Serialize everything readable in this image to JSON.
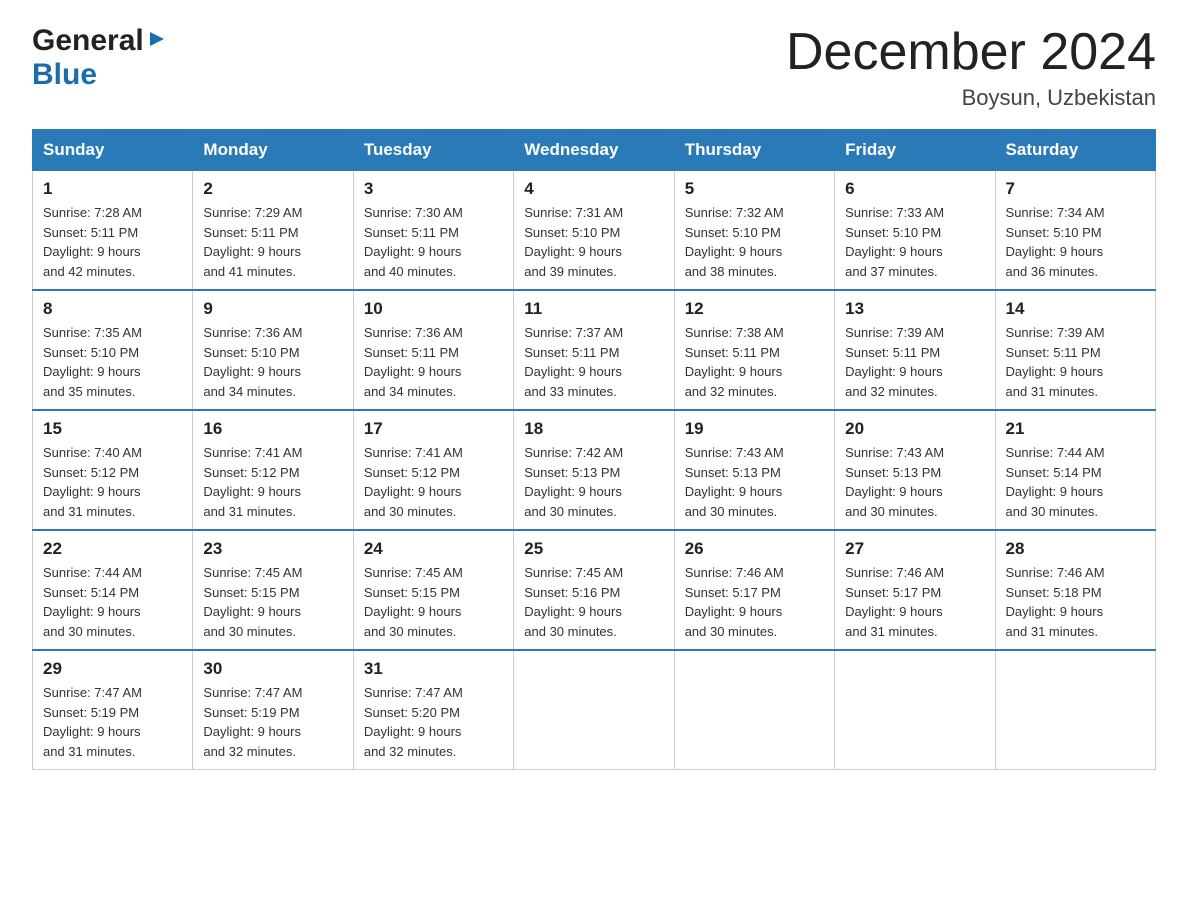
{
  "header": {
    "logo_general": "General",
    "logo_blue": "Blue",
    "title": "December 2024",
    "subtitle": "Boysun, Uzbekistan"
  },
  "days_of_week": [
    "Sunday",
    "Monday",
    "Tuesday",
    "Wednesday",
    "Thursday",
    "Friday",
    "Saturday"
  ],
  "weeks": [
    [
      {
        "day": "1",
        "sunrise": "7:28 AM",
        "sunset": "5:11 PM",
        "daylight": "9 hours and 42 minutes."
      },
      {
        "day": "2",
        "sunrise": "7:29 AM",
        "sunset": "5:11 PM",
        "daylight": "9 hours and 41 minutes."
      },
      {
        "day": "3",
        "sunrise": "7:30 AM",
        "sunset": "5:11 PM",
        "daylight": "9 hours and 40 minutes."
      },
      {
        "day": "4",
        "sunrise": "7:31 AM",
        "sunset": "5:10 PM",
        "daylight": "9 hours and 39 minutes."
      },
      {
        "day": "5",
        "sunrise": "7:32 AM",
        "sunset": "5:10 PM",
        "daylight": "9 hours and 38 minutes."
      },
      {
        "day": "6",
        "sunrise": "7:33 AM",
        "sunset": "5:10 PM",
        "daylight": "9 hours and 37 minutes."
      },
      {
        "day": "7",
        "sunrise": "7:34 AM",
        "sunset": "5:10 PM",
        "daylight": "9 hours and 36 minutes."
      }
    ],
    [
      {
        "day": "8",
        "sunrise": "7:35 AM",
        "sunset": "5:10 PM",
        "daylight": "9 hours and 35 minutes."
      },
      {
        "day": "9",
        "sunrise": "7:36 AM",
        "sunset": "5:10 PM",
        "daylight": "9 hours and 34 minutes."
      },
      {
        "day": "10",
        "sunrise": "7:36 AM",
        "sunset": "5:11 PM",
        "daylight": "9 hours and 34 minutes."
      },
      {
        "day": "11",
        "sunrise": "7:37 AM",
        "sunset": "5:11 PM",
        "daylight": "9 hours and 33 minutes."
      },
      {
        "day": "12",
        "sunrise": "7:38 AM",
        "sunset": "5:11 PM",
        "daylight": "9 hours and 32 minutes."
      },
      {
        "day": "13",
        "sunrise": "7:39 AM",
        "sunset": "5:11 PM",
        "daylight": "9 hours and 32 minutes."
      },
      {
        "day": "14",
        "sunrise": "7:39 AM",
        "sunset": "5:11 PM",
        "daylight": "9 hours and 31 minutes."
      }
    ],
    [
      {
        "day": "15",
        "sunrise": "7:40 AM",
        "sunset": "5:12 PM",
        "daylight": "9 hours and 31 minutes."
      },
      {
        "day": "16",
        "sunrise": "7:41 AM",
        "sunset": "5:12 PM",
        "daylight": "9 hours and 31 minutes."
      },
      {
        "day": "17",
        "sunrise": "7:41 AM",
        "sunset": "5:12 PM",
        "daylight": "9 hours and 30 minutes."
      },
      {
        "day": "18",
        "sunrise": "7:42 AM",
        "sunset": "5:13 PM",
        "daylight": "9 hours and 30 minutes."
      },
      {
        "day": "19",
        "sunrise": "7:43 AM",
        "sunset": "5:13 PM",
        "daylight": "9 hours and 30 minutes."
      },
      {
        "day": "20",
        "sunrise": "7:43 AM",
        "sunset": "5:13 PM",
        "daylight": "9 hours and 30 minutes."
      },
      {
        "day": "21",
        "sunrise": "7:44 AM",
        "sunset": "5:14 PM",
        "daylight": "9 hours and 30 minutes."
      }
    ],
    [
      {
        "day": "22",
        "sunrise": "7:44 AM",
        "sunset": "5:14 PM",
        "daylight": "9 hours and 30 minutes."
      },
      {
        "day": "23",
        "sunrise": "7:45 AM",
        "sunset": "5:15 PM",
        "daylight": "9 hours and 30 minutes."
      },
      {
        "day": "24",
        "sunrise": "7:45 AM",
        "sunset": "5:15 PM",
        "daylight": "9 hours and 30 minutes."
      },
      {
        "day": "25",
        "sunrise": "7:45 AM",
        "sunset": "5:16 PM",
        "daylight": "9 hours and 30 minutes."
      },
      {
        "day": "26",
        "sunrise": "7:46 AM",
        "sunset": "5:17 PM",
        "daylight": "9 hours and 30 minutes."
      },
      {
        "day": "27",
        "sunrise": "7:46 AM",
        "sunset": "5:17 PM",
        "daylight": "9 hours and 31 minutes."
      },
      {
        "day": "28",
        "sunrise": "7:46 AM",
        "sunset": "5:18 PM",
        "daylight": "9 hours and 31 minutes."
      }
    ],
    [
      {
        "day": "29",
        "sunrise": "7:47 AM",
        "sunset": "5:19 PM",
        "daylight": "9 hours and 31 minutes."
      },
      {
        "day": "30",
        "sunrise": "7:47 AM",
        "sunset": "5:19 PM",
        "daylight": "9 hours and 32 minutes."
      },
      {
        "day": "31",
        "sunrise": "7:47 AM",
        "sunset": "5:20 PM",
        "daylight": "9 hours and 32 minutes."
      },
      null,
      null,
      null,
      null
    ]
  ],
  "labels": {
    "sunrise_prefix": "Sunrise: ",
    "sunset_prefix": "Sunset: ",
    "daylight_prefix": "Daylight: "
  }
}
